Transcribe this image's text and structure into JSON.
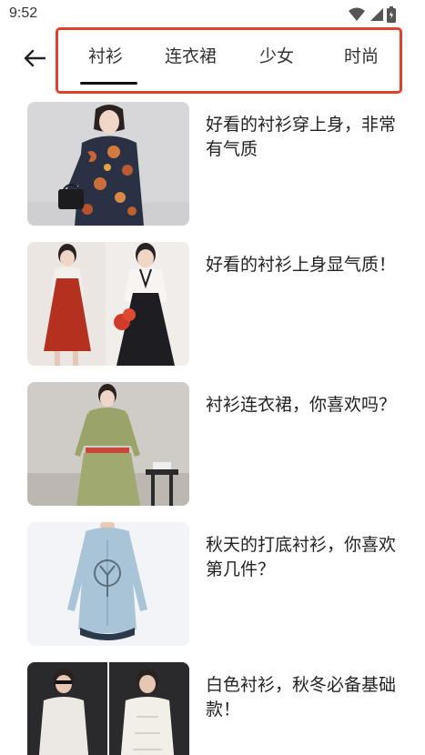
{
  "status_bar": {
    "time": "9:52"
  },
  "tabs": [
    {
      "label": "衬衫"
    },
    {
      "label": "连衣裙"
    },
    {
      "label": "少女"
    },
    {
      "label": "时尚"
    }
  ],
  "active_tab": "衬衫",
  "feed": [
    {
      "title": "好看的衬衫穿上身，非常有气质",
      "image": "woman-floral-shirt-photo"
    },
    {
      "title": "好看的衬衫上身显气质！",
      "image": "red-black-dress-photo"
    },
    {
      "title": "衬衫连衣裙，你喜欢吗？",
      "image": "green-shirt-dress-photo"
    },
    {
      "title": "秋天的打底衬衫，你喜欢第几件？",
      "image": "blue-tree-print-shirt-photo"
    },
    {
      "title": "白色衬衫，秋冬必备基础款！",
      "image": "white-shirt-photo"
    }
  ],
  "colors": {
    "highlight_frame": "#e0412b",
    "indicator": "#111111"
  }
}
